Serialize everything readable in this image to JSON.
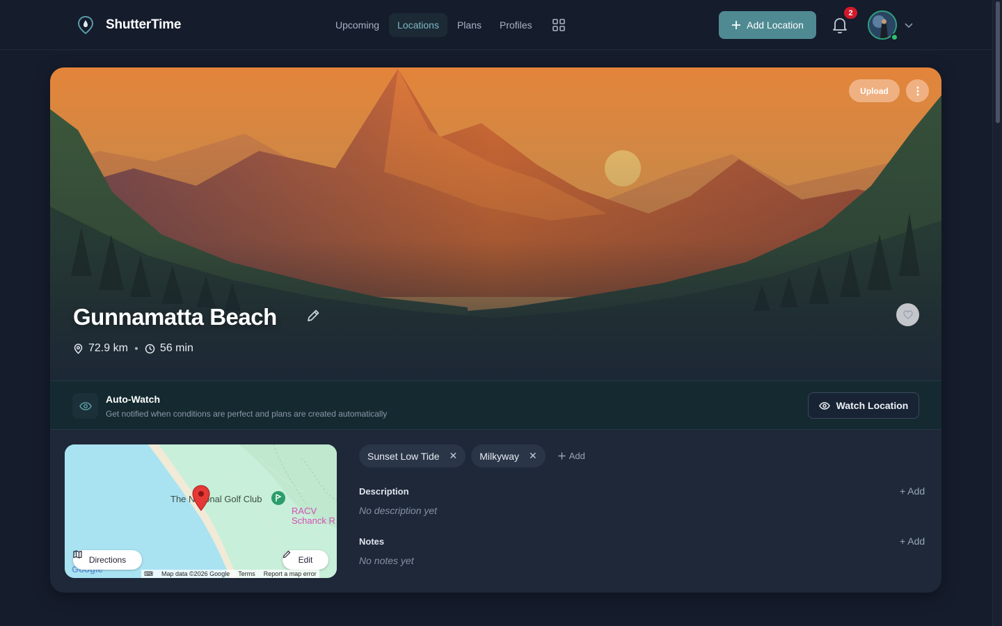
{
  "brand": {
    "name": "ShutterTime",
    "logo_icon": "map-pin-logo-icon"
  },
  "nav": {
    "items": [
      {
        "label": "Upcoming",
        "active": false
      },
      {
        "label": "Locations",
        "active": true
      },
      {
        "label": "Plans",
        "active": false
      },
      {
        "label": "Profiles",
        "active": false
      }
    ],
    "grid_icon": "grid-icon"
  },
  "header_actions": {
    "add_location_label": "Add Location",
    "notification_count": "2",
    "avatar_icon": "user-avatar"
  },
  "location": {
    "title": "Gunnamatta Beach",
    "distance": "72.9 km",
    "duration": "56 min",
    "upload_label": "Upload"
  },
  "auto_watch": {
    "title": "Auto-Watch",
    "subtitle": "Get notified when conditions are perfect and plans are created automatically",
    "button_label": "Watch Location"
  },
  "map": {
    "label_golf": "The National Golf Club",
    "label_racv_line1": "RACV",
    "label_racv_line2": "Schanck R",
    "directions_label": "Directions",
    "edit_label": "Edit",
    "footer": {
      "map_data": "Map data ©2026 Google",
      "terms": "Terms",
      "report": "Report a map error"
    },
    "google_mark": "Google"
  },
  "tags": {
    "items": [
      "Sunset Low Tide",
      "Milkyway"
    ],
    "add_label": "Add"
  },
  "description": {
    "title": "Description",
    "empty": "No description yet",
    "add_label": "+ Add"
  },
  "notes": {
    "title": "Notes",
    "empty": "No notes yet",
    "add_label": "+ Add"
  },
  "colors": {
    "background": "#151c2c",
    "accent": "#4f8a93",
    "badge": "#d11a2a",
    "autowatch_band": "#142a30"
  }
}
